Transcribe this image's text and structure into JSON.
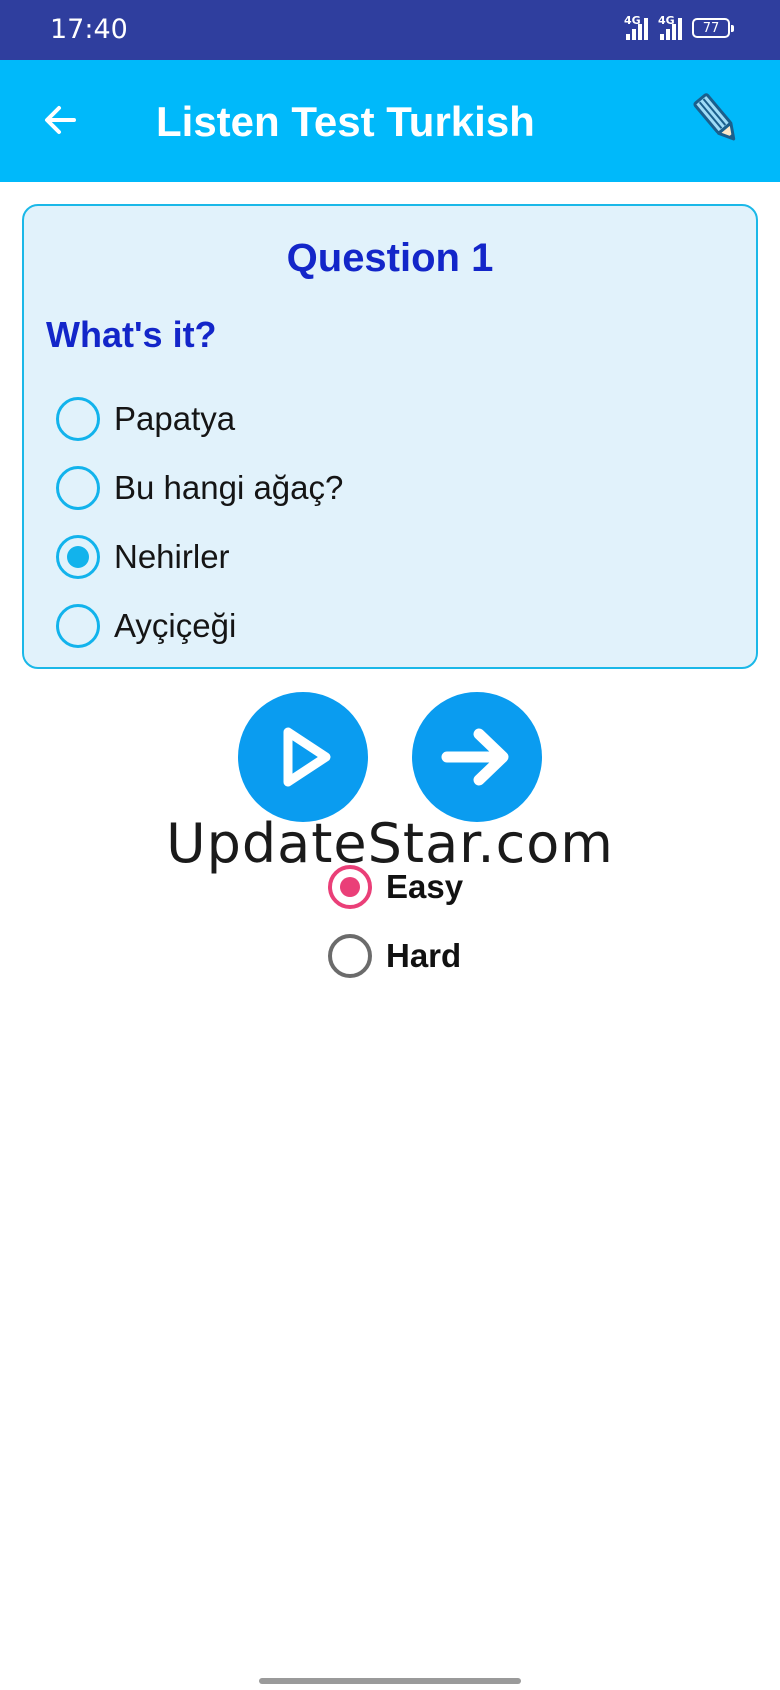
{
  "status_bar": {
    "time": "17:40",
    "network_1": "4G",
    "network_2": "4G",
    "battery": "77"
  },
  "app_bar": {
    "title": "Listen Test Turkish",
    "back_icon": "arrow-left-icon",
    "edit_icon": "pencil-icon"
  },
  "question": {
    "title": "Question 1",
    "prompt": "What's it?",
    "options": [
      {
        "label": "Papatya",
        "selected": false
      },
      {
        "label": "Bu hangi ağaç?",
        "selected": false
      },
      {
        "label": "Nehirler",
        "selected": true
      },
      {
        "label": "Ayçiçeği",
        "selected": false
      }
    ]
  },
  "controls": {
    "play_icon": "play-icon",
    "next_icon": "arrow-right-icon"
  },
  "watermark": "UpdateStar.com",
  "difficulty": {
    "options": [
      {
        "label": "Easy",
        "selected": true
      },
      {
        "label": "Hard",
        "selected": false
      }
    ]
  },
  "colors": {
    "status_bar": "#2f3e9e",
    "app_bar": "#00b9fa",
    "card_background": "#e1f2fb",
    "card_border": "#1ab8e8",
    "question_text": "#1326c9",
    "radio_accent": "#12b3ec",
    "button": "#0a9cf0",
    "difficulty_accent": "#ea3f78"
  }
}
